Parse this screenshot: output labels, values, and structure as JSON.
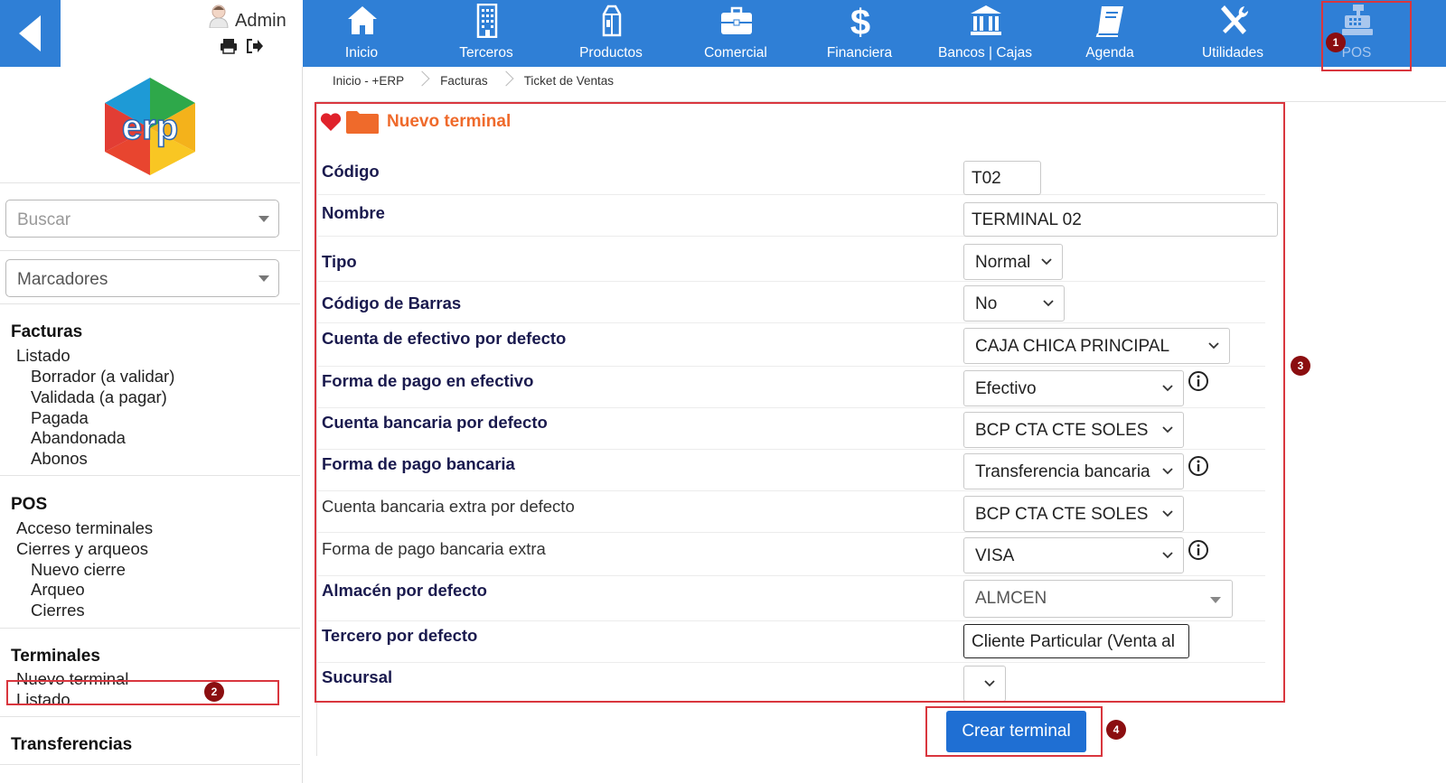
{
  "user": {
    "name": "Admin"
  },
  "sidebar": {
    "search_placeholder": "Buscar",
    "bookmarks_label": "Marcadores",
    "sections": {
      "facturas": {
        "title": "Facturas",
        "listado": "Listado",
        "borrador": "Borrador (a validar)",
        "validada": "Validada (a pagar)",
        "pagada": "Pagada",
        "abandonada": "Abandonada",
        "abonos": "Abonos"
      },
      "pos": {
        "title": "POS",
        "acceso": "Acceso terminales",
        "cierres": "Cierres y arqueos",
        "nuevo_cierre": "Nuevo cierre",
        "arqueo": "Arqueo",
        "cierres_sub": "Cierres"
      },
      "terminales": {
        "title": "Terminales",
        "nuevo": "Nuevo terminal",
        "listado": "Listado"
      },
      "transferencias": {
        "title": "Transferencias"
      }
    }
  },
  "topnav": {
    "inicio": "Inicio",
    "terceros": "Terceros",
    "productos": "Productos",
    "comercial": "Comercial",
    "financiera": "Financiera",
    "bancos": "Bancos | Cajas",
    "agenda": "Agenda",
    "utilidades": "Utilidades",
    "pos": "POS"
  },
  "breadcrumb": [
    "Inicio - +ERP",
    "Facturas",
    "Ticket de Ventas"
  ],
  "form": {
    "title": "Nuevo terminal",
    "fields": {
      "codigo": {
        "label": "Código",
        "value": "T02"
      },
      "nombre": {
        "label": "Nombre",
        "value": "TERMINAL 02"
      },
      "tipo": {
        "label": "Tipo",
        "value": "Normal"
      },
      "barras": {
        "label": "Código de Barras",
        "value": "No"
      },
      "efectivo": {
        "label": "Cuenta de efectivo por defecto",
        "value": "CAJA CHICA PRINCIPAL"
      },
      "pago_efectivo": {
        "label": "Forma de pago en efectivo",
        "value": "Efectivo"
      },
      "bancaria": {
        "label": "Cuenta bancaria por defecto",
        "value": "BCP CTA CTE SOLES"
      },
      "pago_bancaria": {
        "label": "Forma de pago bancaria",
        "value": "Transferencia bancaria"
      },
      "bancaria_extra": {
        "label": "Cuenta bancaria extra por defecto",
        "value": "BCP CTA CTE SOLES"
      },
      "pago_extra": {
        "label": "Forma de pago bancaria extra",
        "value": "VISA"
      },
      "almacen": {
        "label": "Almacén por defecto",
        "value": "ALMCEN"
      },
      "tercero": {
        "label": "Tercero por defecto",
        "value": "Cliente Particular (Venta al"
      },
      "sucursal": {
        "label": "Sucursal",
        "value": ""
      }
    },
    "submit_label": "Crear terminal"
  },
  "annotations": [
    "1",
    "2",
    "3",
    "4"
  ],
  "colors": {
    "nav_bg": "#2f7fd6",
    "title_orange": "#ef6a2b",
    "annotation_red": "#d9363e",
    "badge": "#8b0e10",
    "button": "#1f6fd3"
  }
}
